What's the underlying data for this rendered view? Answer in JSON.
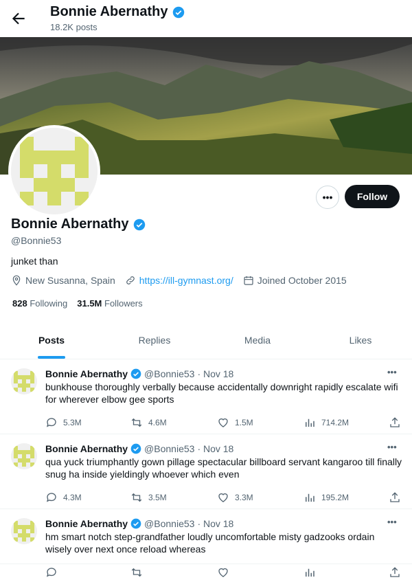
{
  "header": {
    "name": "Bonnie Abernathy",
    "posts_count": "18.2K posts"
  },
  "profile": {
    "name": "Bonnie Abernathy",
    "handle": "@Bonnie53",
    "bio": "junket than",
    "location": "New Susanna, Spain",
    "website": "https://ill-gymnast.org/",
    "joined": "Joined October 2015",
    "following_count": "828",
    "following_label": "Following",
    "followers_count": "31.5M",
    "followers_label": "Followers",
    "follow_label": "Follow",
    "more_label": "•••"
  },
  "tabs": [
    {
      "label": "Posts",
      "active": true
    },
    {
      "label": "Replies"
    },
    {
      "label": "Media"
    },
    {
      "label": "Likes"
    }
  ],
  "tweets": [
    {
      "name": "Bonnie Abernathy",
      "handle": "@Bonnie53",
      "date": "· Nov 18",
      "text": "bunkhouse thoroughly verbally because accidentally downright rapidly escalate wifi for wherever elbow gee sports",
      "replies": "5.3M",
      "retweets": "4.6M",
      "likes": "1.5M",
      "views": "714.2M"
    },
    {
      "name": "Bonnie Abernathy",
      "handle": "@Bonnie53",
      "date": "· Nov 18",
      "text": "qua yuck triumphantly gown pillage spectacular billboard servant kangaroo till finally snug ha inside yieldingly whoever which even",
      "replies": "4.3M",
      "retweets": "3.5M",
      "likes": "3.3M",
      "views": "195.2M"
    },
    {
      "name": "Bonnie Abernathy",
      "handle": "@Bonnie53",
      "date": "· Nov 18",
      "text": "hm smart notch step-grandfather loudly uncomfortable misty gadzooks ordain wisely over next once reload whereas",
      "replies": "",
      "retweets": "",
      "likes": "",
      "views": ""
    }
  ],
  "tweet_more_label": "•••",
  "colors": {
    "accent": "#1d9bf0",
    "avatar_pattern": "#d4dc6a",
    "text": "#0f1419",
    "muted": "#536471"
  }
}
